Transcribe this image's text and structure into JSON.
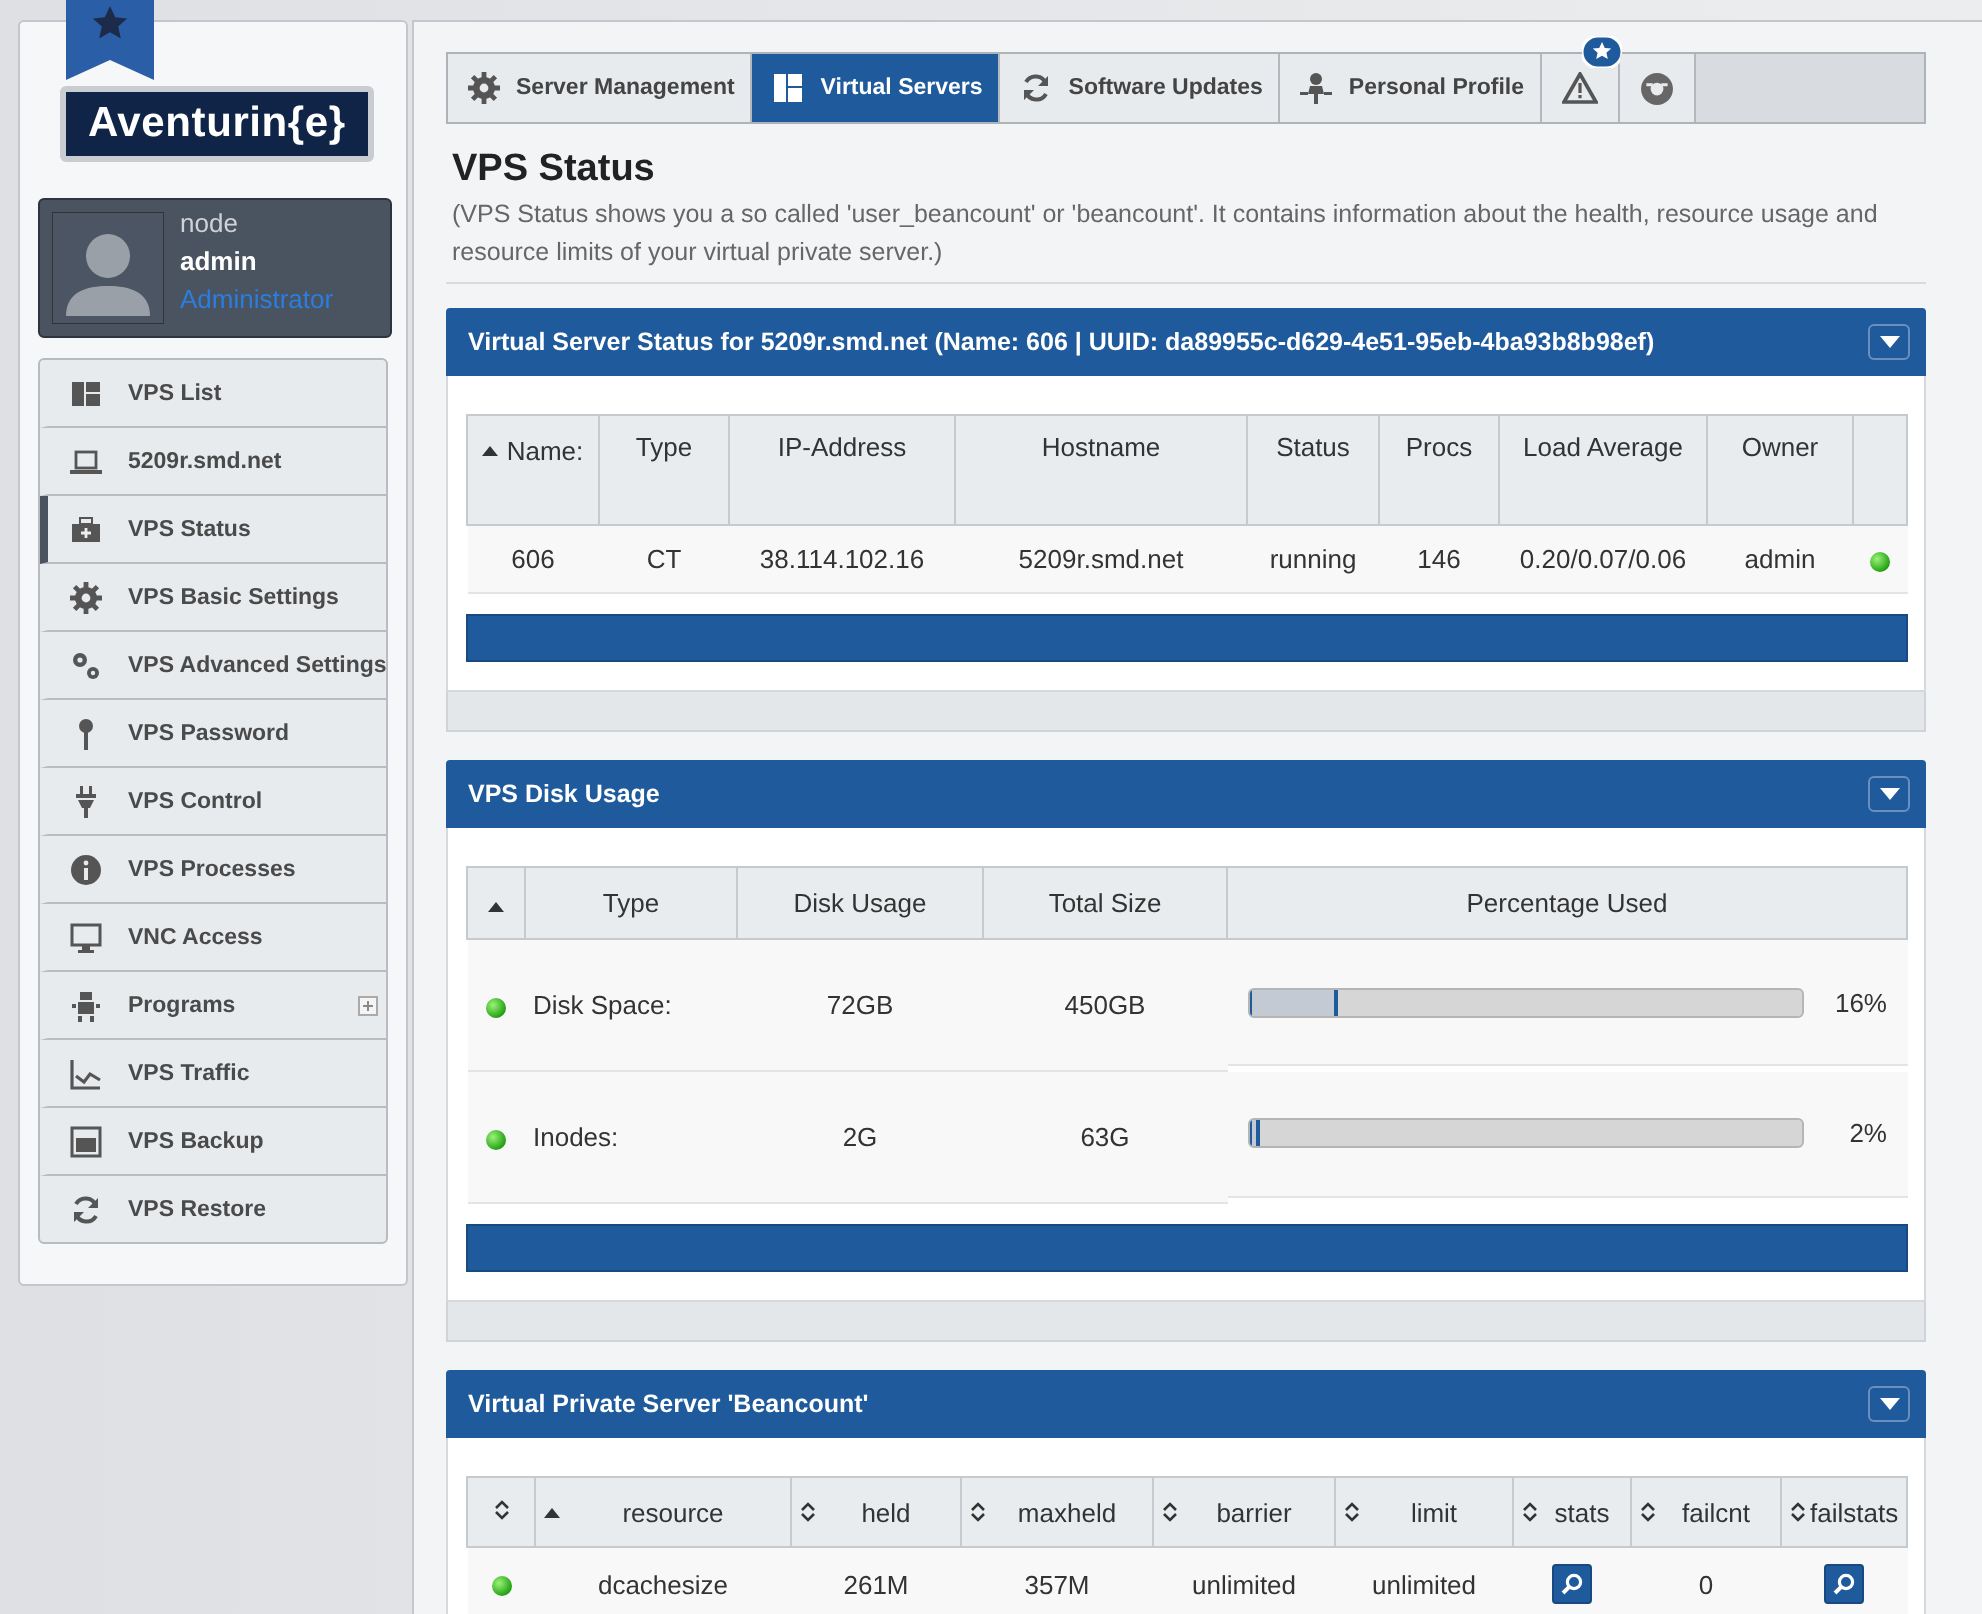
{
  "logo": {
    "text": "Aventurin{e}"
  },
  "profile": {
    "node": "node",
    "user": "admin",
    "role": "Administrator"
  },
  "sidebar": {
    "items": [
      {
        "label": "VPS List",
        "selected": false,
        "has_submenu": false
      },
      {
        "label": "5209r.smd.net",
        "selected": false,
        "has_submenu": false
      },
      {
        "label": "VPS Status",
        "selected": true,
        "has_submenu": false
      },
      {
        "label": "VPS Basic Settings",
        "selected": false,
        "has_submenu": false
      },
      {
        "label": "VPS Advanced Settings",
        "selected": false,
        "has_submenu": false
      },
      {
        "label": "VPS Password",
        "selected": false,
        "has_submenu": false
      },
      {
        "label": "VPS Control",
        "selected": false,
        "has_submenu": false
      },
      {
        "label": "VPS Processes",
        "selected": false,
        "has_submenu": false
      },
      {
        "label": "VNC Access",
        "selected": false,
        "has_submenu": false
      },
      {
        "label": "Programs",
        "selected": false,
        "has_submenu": true
      },
      {
        "label": "VPS Traffic",
        "selected": false,
        "has_submenu": false
      },
      {
        "label": "VPS Backup",
        "selected": false,
        "has_submenu": false
      },
      {
        "label": "VPS Restore",
        "selected": false,
        "has_submenu": false
      }
    ]
  },
  "tabs": [
    {
      "label": "Server Management",
      "selected": false
    },
    {
      "label": "Virtual Servers",
      "selected": true
    },
    {
      "label": "Software Updates",
      "selected": false
    },
    {
      "label": "Personal Profile",
      "selected": false
    }
  ],
  "page": {
    "title": "VPS Status",
    "description": "(VPS Status shows you a so called 'user_beancount' or 'beancount'. It contains information about the health, resource usage and resource limits of your virtual private server.)"
  },
  "status_panel": {
    "title": "Virtual Server Status for 5209r.smd.net (Name: 606 | UUID: da89955c-d629-4e51-95eb-4ba93b8b98ef)",
    "columns": [
      {
        "label": "Name:",
        "sorted": true
      },
      {
        "label": "Type",
        "sorted": false
      },
      {
        "label": "IP-Address",
        "sorted": false
      },
      {
        "label": "Hostname",
        "sorted": false
      },
      {
        "label": "Status",
        "sorted": false
      },
      {
        "label": "Procs",
        "sorted": false
      },
      {
        "label": "Load Average",
        "sorted": false
      },
      {
        "label": "Owner",
        "sorted": false
      }
    ],
    "rows": [
      {
        "cells": [
          "606",
          "CT",
          "38.114.102.16",
          "5209r.smd.net",
          "running",
          "146",
          "0.20/0.07/0.06",
          "admin"
        ]
      }
    ]
  },
  "disk_panel": {
    "title": "VPS Disk Usage",
    "columns": [
      {
        "label": "Type"
      },
      {
        "label": "Disk Usage"
      },
      {
        "label": "Total Size"
      },
      {
        "label": "Percentage Used"
      }
    ],
    "rows": [
      {
        "type": "Disk Space:",
        "usage": "72GB",
        "total": "450GB",
        "level": 0.16,
        "percent": "16%"
      },
      {
        "type": "Inodes:",
        "usage": "2G",
        "total": "63G",
        "level": 0.02,
        "percent": "2%"
      }
    ]
  },
  "beancount_panel": {
    "title": "Virtual Private Server 'Beancount'",
    "columns": [
      {
        "label": "resource",
        "sorted": true
      },
      {
        "label": "held",
        "sorted": false
      },
      {
        "label": "maxheld",
        "sorted": false
      },
      {
        "label": "barrier",
        "sorted": false
      },
      {
        "label": "limit",
        "sorted": false
      },
      {
        "label": "stats",
        "sorted": false
      },
      {
        "label": "failcnt",
        "sorted": false
      },
      {
        "label": "failstats",
        "sorted": false
      }
    ],
    "rows": [
      {
        "resource": "dcachesize",
        "held": "261M",
        "maxheld": "357M",
        "barrier": "unlimited",
        "limit": "unlimited",
        "failcnt": "0"
      }
    ]
  }
}
